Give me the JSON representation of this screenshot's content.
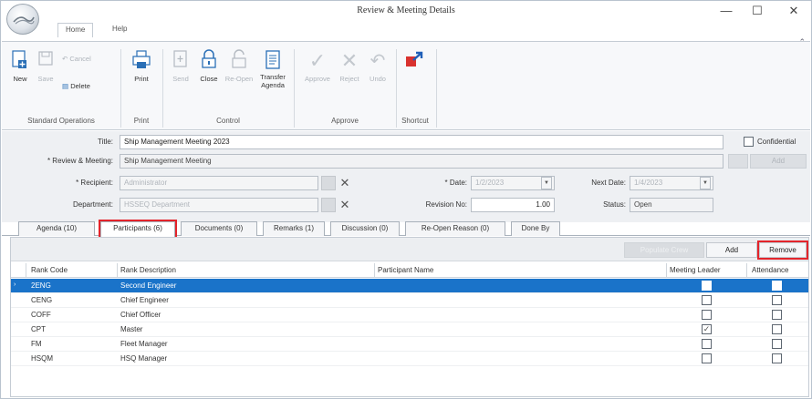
{
  "window": {
    "title": "Review & Meeting Details",
    "minimize": "—",
    "maximize": "☐",
    "close": "✕"
  },
  "ribbon_tabs": [
    {
      "label": "Home"
    },
    {
      "label": "Help"
    }
  ],
  "ribbon": {
    "new": "New",
    "save": "Save",
    "cancel": "Cancel",
    "delete": "Delete",
    "print": "Print",
    "send": "Send",
    "close": "Close",
    "reopen": "Re-Open",
    "transfer_agenda": "Transfer Agenda",
    "approve": "Approve",
    "reject": "Reject",
    "undo": "Undo",
    "groups": {
      "standard": "Standard Operations",
      "print": "Print",
      "control": "Control",
      "approve": "Approve",
      "shortcut": "Shortcut"
    }
  },
  "form": {
    "title_label": "Title:",
    "title_value": "Ship Management Meeting 2023",
    "confidential_label": "Confidential",
    "meeting_label": "* Review & Meeting:",
    "meeting_value": "Ship Management Meeting",
    "recipient_label": "* Recipient:",
    "recipient_value": "Administrator",
    "department_label": "Department:",
    "department_value": "HSSEQ Department",
    "date_label": "* Date:",
    "date_value": "1/2/2023",
    "revision_label": "Revision No:",
    "revision_value": "1.00",
    "next_date_label": "Next Date:",
    "next_date_value": "1/4/2023",
    "status_label": "Status:",
    "status_value": "Open",
    "side_button": "Add"
  },
  "detail_tabs": [
    {
      "label": "Agenda (10)"
    },
    {
      "label": "Participants (6)"
    },
    {
      "label": "Documents (0)"
    },
    {
      "label": "Remarks (1)"
    },
    {
      "label": "Discussion (0)"
    },
    {
      "label": "Re-Open Reason (0)"
    },
    {
      "label": "Done By"
    }
  ],
  "grid": {
    "buttons": {
      "disabled": "Populate Crew",
      "add": "Add",
      "remove": "Remove"
    },
    "columns": {
      "rank_code": "Rank Code",
      "rank_description": "Rank Description",
      "participant_name": "Participant Name",
      "meeting_leader": "Meeting Leader",
      "attendance": "Attendance"
    },
    "rows": [
      {
        "code": "2ENG",
        "description": "Second Engineer",
        "name": "",
        "leader": false,
        "attendance": false,
        "selected": true
      },
      {
        "code": "CENG",
        "description": "Chief Engineer",
        "name": "",
        "leader": false,
        "attendance": false,
        "selected": false
      },
      {
        "code": "COFF",
        "description": "Chief Officer",
        "name": "",
        "leader": false,
        "attendance": false,
        "selected": false
      },
      {
        "code": "CPT",
        "description": "Master",
        "name": "",
        "leader": true,
        "attendance": false,
        "selected": false
      },
      {
        "code": "FM",
        "description": "Fleet Manager",
        "name": "",
        "leader": false,
        "attendance": false,
        "selected": false
      },
      {
        "code": "HSQM",
        "description": "HSQ Manager",
        "name": "",
        "leader": false,
        "attendance": false,
        "selected": false
      }
    ]
  },
  "colors": {
    "accent": "#1a73c9",
    "highlight": "#e3242b",
    "shortcut_red": "#d9322e",
    "shortcut_blue": "#1f5fb8"
  }
}
